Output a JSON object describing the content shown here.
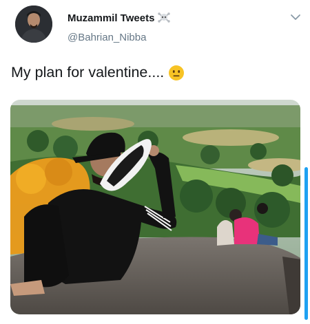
{
  "tweet": {
    "display_name": "Muzammil Tweets",
    "handle": "@Bahrian_Nibba",
    "text": "My plan for valentine....",
    "name_icon": "skull-crossbones-icon",
    "text_emoji": "neutral-face-emoji",
    "menu_icon": "chevron-down-icon",
    "media_alt": "photo"
  },
  "colors": {
    "primary_text": "#14171a",
    "secondary_text": "#657786",
    "scrollbar": "#1ea1f2"
  }
}
